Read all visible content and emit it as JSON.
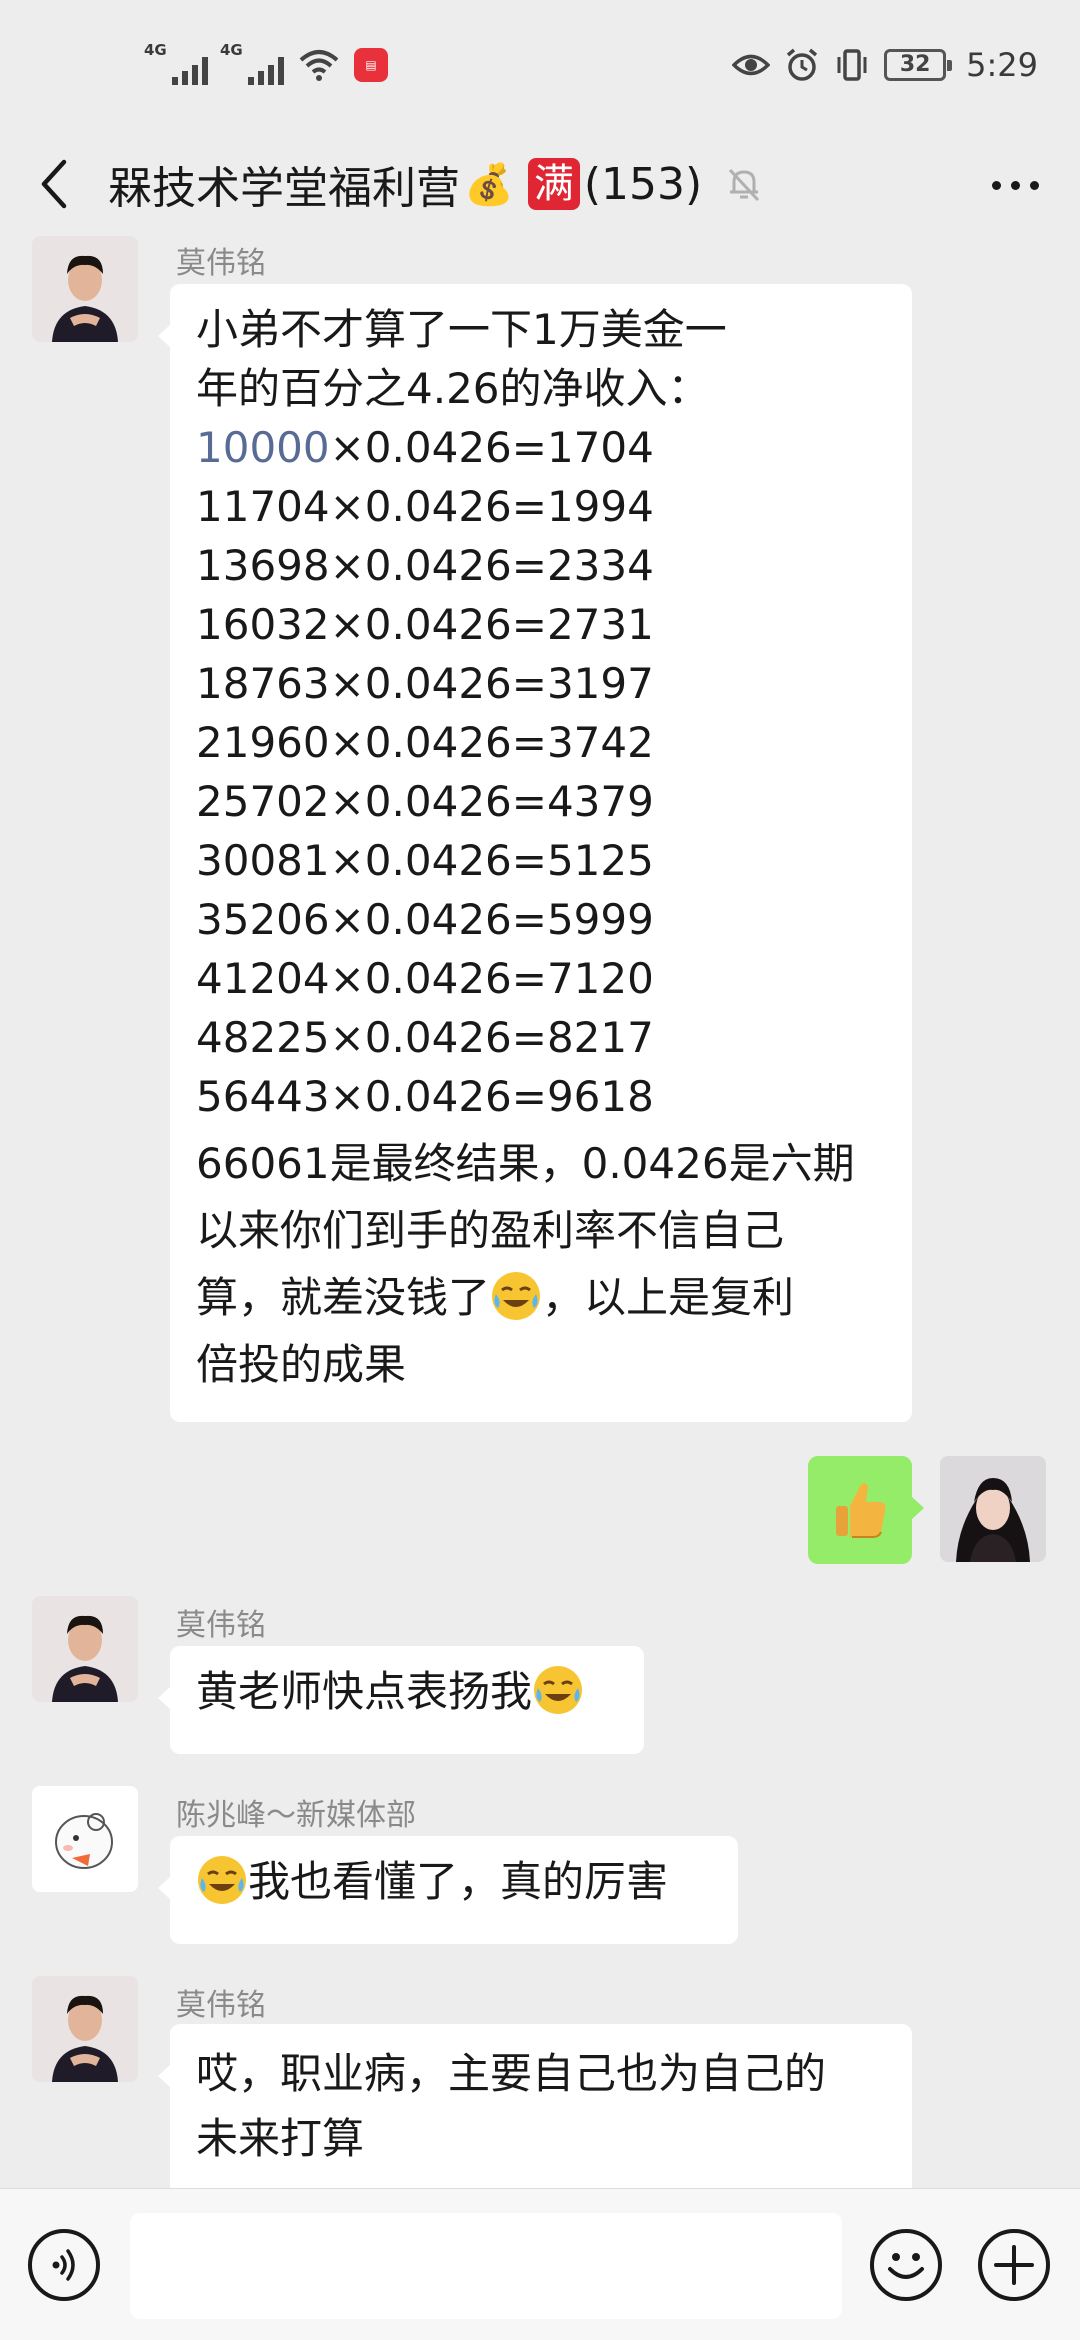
{
  "status_bar": {
    "signal1_label": "4G",
    "signal2_label": "4G",
    "battery_level": "32",
    "time": "5:29"
  },
  "header": {
    "title": "槑技术学堂福利营",
    "bag_emoji": "💰",
    "full_badge": "满",
    "member_count": "(153)"
  },
  "messages": [
    {
      "sender": "莫伟铭",
      "side": "left",
      "lines": [
        "小弟不才算了一下1万美金一",
        "年的百分之4.26的净收入：",
        "10000×0.0426=1704",
        "11704×0.0426=1994",
        "13698×0.0426=2334",
        "16032×0.0426=2731",
        "18763×0.0426=3197",
        "21960×0.0426=3742",
        "25702×0.0426=4379",
        "30081×0.0426=5125",
        "35206×0.0426=5999",
        "41204×0.0426=7120",
        "48225×0.0426=8217",
        "56443×0.0426=9618",
        "66061是最终结果，0.0426是六期",
        "以来你们到手的盈利率不信自己",
        "算，就差没钱了",
        "，以上是复利",
        "倍投的成果"
      ],
      "link_text": "10000",
      "link_rest": "×0.0426=1704"
    },
    {
      "sender": "",
      "side": "right",
      "content": "thumbs-up sticker"
    },
    {
      "sender": "莫伟铭",
      "side": "left",
      "text": "黄老师快点表扬我"
    },
    {
      "sender": "陈兆峰～新媒体部",
      "side": "left",
      "text": "我也看懂了，真的厉害"
    },
    {
      "sender": "莫伟铭",
      "side": "left",
      "lines": [
        "哎，职业病，主要自己也为自己的",
        "未来打算"
      ]
    }
  ],
  "colors": {
    "background": "#ededed",
    "bubble_left": "#ffffff",
    "bubble_self": "#95ec69",
    "link": "#576b95",
    "badge_red": "#e02633"
  },
  "icons": [
    "back-arrow-icon",
    "mute-bell-icon",
    "more-dots-icon",
    "voice-icon",
    "emoji-icon",
    "plus-icon",
    "thumbs-up-icon",
    "crying-laugh-emoji"
  ]
}
